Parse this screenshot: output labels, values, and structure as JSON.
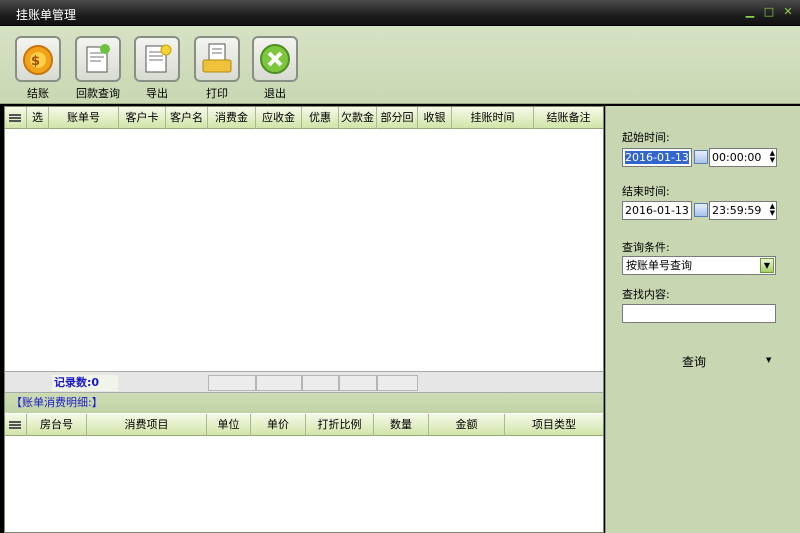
{
  "window": {
    "title": "挂账单管理",
    "min": "▁",
    "max": "□",
    "close": "✕"
  },
  "toolbar": {
    "buttons": [
      {
        "label": "结账",
        "icon": "coins-icon"
      },
      {
        "label": "回款查询",
        "icon": "document-search-icon"
      },
      {
        "label": "导出",
        "icon": "export-icon"
      },
      {
        "label": "打印",
        "icon": "printer-icon"
      },
      {
        "label": "退出",
        "icon": "exit-icon"
      }
    ]
  },
  "main_table": {
    "columns": [
      "选",
      "账单号",
      "客户卡",
      "客户名",
      "消费金",
      "应收金",
      "优惠",
      "欠款金",
      "部分回",
      "收银",
      "挂账时间",
      "结账备注"
    ],
    "rows": []
  },
  "footer": {
    "record_count": "记录数:0"
  },
  "detail": {
    "title": "【账单消费明细:】",
    "columns": [
      "房台号",
      "消费项目",
      "单位",
      "单价",
      "打折比例",
      "数量",
      "金额",
      "项目类型"
    ],
    "rows": []
  },
  "search": {
    "start_label": "起始时间:",
    "start_date": "2016-01-13",
    "start_time": "00:00:00",
    "end_label": "结束时间:",
    "end_date": "2016-01-13",
    "end_time": "23:59:59",
    "condition_label": "查询条件:",
    "condition_value": "按账单号查询",
    "content_label": "查找内容:",
    "content_value": "",
    "query_label": "查询"
  }
}
